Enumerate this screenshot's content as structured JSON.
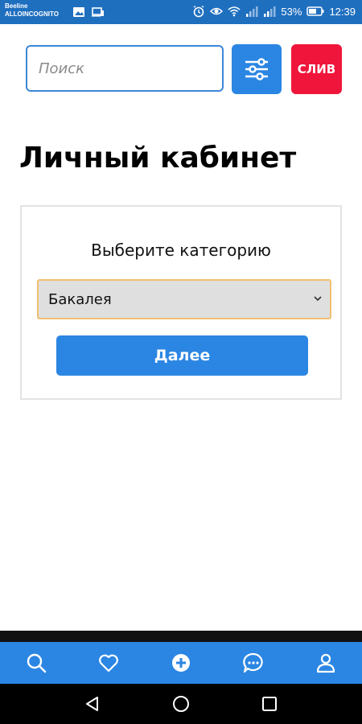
{
  "status_bar": {
    "carrier_line1": "Beeline",
    "carrier_line2": "ALLOINCOGNITO",
    "battery": "53%",
    "time": "12:39",
    "background": "#1f6fbf"
  },
  "search": {
    "placeholder": "Поиск",
    "value": ""
  },
  "filter_button": {
    "icon": "sliders-icon"
  },
  "sliv_button": {
    "label": "СЛИВ",
    "color": "#f0153b"
  },
  "page": {
    "title": "Личный кабинет"
  },
  "category_card": {
    "label": "Выберите категорию",
    "selected_category": "Бакалея",
    "next_label": "Далее"
  },
  "bottom_nav": {
    "items": [
      "search-icon",
      "heart-icon",
      "add-icon",
      "chat-icon",
      "profile-icon"
    ],
    "background": "#2b86e3"
  },
  "system_nav": {
    "items": [
      "back-icon",
      "home-icon",
      "recents-icon"
    ]
  },
  "accent": "#2b86e3"
}
